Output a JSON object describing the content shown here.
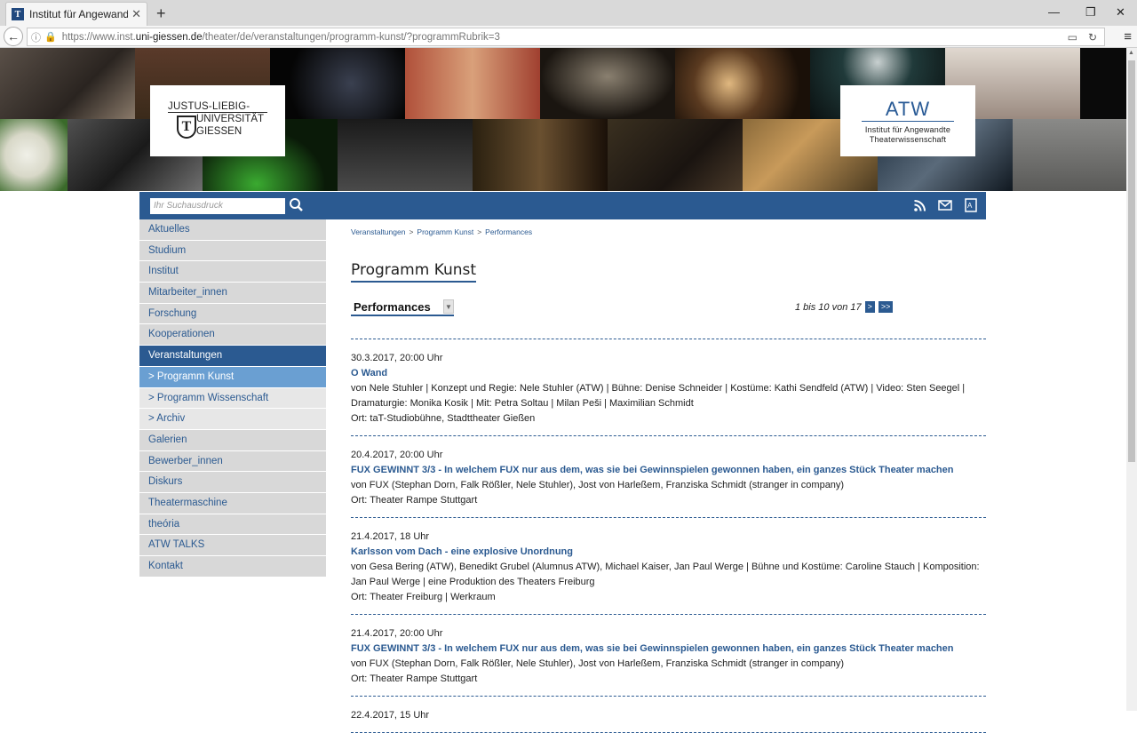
{
  "browser": {
    "tab_title": "Institut für Angewandte The",
    "favicon_letter": "T",
    "url_prefix": "https://www.inst.",
    "url_domain": "uni-giessen.de",
    "url_path": "/theater/de/veranstaltungen/programm-kunst/?programmRubrik=3"
  },
  "banner": {
    "jlu_line1": "JUSTUS-LIEBIG-",
    "jlu_line2": "UNIVERSITÄT",
    "jlu_line3": "GIESSEN",
    "jlu_seal": "T",
    "atw_big": "ATW",
    "atw_line1": "Institut für Angewandte",
    "atw_line2": "Theaterwissenschaft"
  },
  "search": {
    "placeholder": "Ihr Suchausdruck"
  },
  "nav": [
    {
      "label": "Aktuelles",
      "state": "normal"
    },
    {
      "label": "Studium",
      "state": "normal"
    },
    {
      "label": "Institut",
      "state": "normal"
    },
    {
      "label": "Mitarbeiter_innen",
      "state": "normal"
    },
    {
      "label": "Forschung",
      "state": "normal"
    },
    {
      "label": "Kooperationen",
      "state": "normal"
    },
    {
      "label": "Veranstaltungen",
      "state": "active"
    },
    {
      "label": "> Programm Kunst",
      "state": "subactive"
    },
    {
      "label": "> Programm Wissenschaft",
      "state": "sub"
    },
    {
      "label": "> Archiv",
      "state": "sub"
    },
    {
      "label": "Galerien",
      "state": "normal"
    },
    {
      "label": "Bewerber_innen",
      "state": "normal"
    },
    {
      "label": "Diskurs",
      "state": "normal"
    },
    {
      "label": "Theatermaschine",
      "state": "normal"
    },
    {
      "label": "theória",
      "state": "normal"
    },
    {
      "label": "ATW TALKS",
      "state": "normal"
    },
    {
      "label": "Kontakt",
      "state": "normal"
    }
  ],
  "breadcrumb": [
    "Veranstaltungen",
    "Programm Kunst",
    "Performances"
  ],
  "breadcrumb_sep": ">",
  "page_title": "Programm Kunst",
  "rubrik_selected": "Performances",
  "pager": {
    "text": "1 bis 10 von 17",
    "next": ">",
    "last": ">>"
  },
  "events": [
    {
      "date": "30.3.2017, 20:00 Uhr",
      "title": "O Wand",
      "desc": "von Nele Stuhler | Konzept und Regie: Nele Stuhler (ATW) | Bühne: Denise Schneider | Kostüme: Kathi Sendfeld (ATW) | Video: Sten Seegel | Dramaturgie: Monika Kosik | Mit: Petra Soltau | Milan Peši | Maximilian Schmidt",
      "ort": "Ort: taT-Studiobühne, Stadttheater Gießen"
    },
    {
      "date": "20.4.2017, 20:00 Uhr",
      "title": "FUX GEWINNT 3/3 - In welchem FUX nur aus dem, was sie bei Gewinnspielen gewonnen haben, ein ganzes Stück Theater machen",
      "desc": "von FUX (Stephan Dorn, Falk Rößler, Nele Stuhler), Jost von Harleßem, Franziska Schmidt (stranger in company)",
      "ort": "Ort: Theater Rampe Stuttgart"
    },
    {
      "date": "21.4.2017, 18 Uhr",
      "title": "Karlsson vom Dach - eine explosive Unordnung",
      "desc": "von Gesa Bering (ATW), Benedikt Grubel (Alumnus ATW), Michael Kaiser, Jan Paul Werge | Bühne und Kostüme: Caroline Stauch | Komposition: Jan Paul Werge | eine Produktion des Theaters Freiburg",
      "ort": "Ort: Theater Freiburg | Werkraum"
    },
    {
      "date": "21.4.2017, 20:00 Uhr",
      "title": "FUX GEWINNT 3/3 - In welchem FUX nur aus dem, was sie bei Gewinnspielen gewonnen haben, ein ganzes Stück Theater machen",
      "desc": "von FUX (Stephan Dorn, Falk Rößler, Nele Stuhler), Jost von Harleßem, Franziska Schmidt (stranger in company)",
      "ort": "Ort: Theater Rampe Stuttgart"
    },
    {
      "date": "22.4.2017, 15 Uhr",
      "title": "",
      "desc": "",
      "ort": ""
    }
  ],
  "colors": {
    "brand_blue": "#2b5a91",
    "sub_active": "#6a9fd2",
    "nav_bg": "#d8d8d8"
  }
}
